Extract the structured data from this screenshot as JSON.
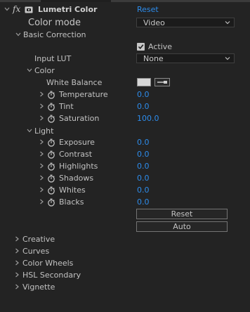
{
  "effect": {
    "fx_label": "fx",
    "name": "Lumetri Color",
    "reset_label": "Reset"
  },
  "color_mode": {
    "label": "Color mode",
    "value": "Video"
  },
  "basic_correction": {
    "label": "Basic Correction",
    "active_label": "Active",
    "active_checked": true,
    "input_lut_label": "Input LUT",
    "input_lut_value": "None",
    "color_section": {
      "label": "Color",
      "white_balance_label": "White Balance",
      "properties": [
        {
          "label": "Temperature",
          "value": "0.0"
        },
        {
          "label": "Tint",
          "value": "0.0"
        },
        {
          "label": "Saturation",
          "value": "100.0"
        }
      ]
    },
    "light_section": {
      "label": "Light",
      "properties": [
        {
          "label": "Exposure",
          "value": "0.0"
        },
        {
          "label": "Contrast",
          "value": "0.0"
        },
        {
          "label": "Highlights",
          "value": "0.0"
        },
        {
          "label": "Shadows",
          "value": "0.0"
        },
        {
          "label": "Whites",
          "value": "0.0"
        },
        {
          "label": "Blacks",
          "value": "0.0"
        }
      ]
    },
    "reset_button_label": "Reset",
    "auto_button_label": "Auto"
  },
  "collapsed_sections": [
    {
      "label": "Creative"
    },
    {
      "label": "Curves"
    },
    {
      "label": "Color Wheels"
    },
    {
      "label": "HSL Secondary"
    },
    {
      "label": "Vignette"
    }
  ],
  "colors": {
    "background": "#232323",
    "value_blue": "#2d8ceb",
    "text": "#c2c2c2"
  }
}
